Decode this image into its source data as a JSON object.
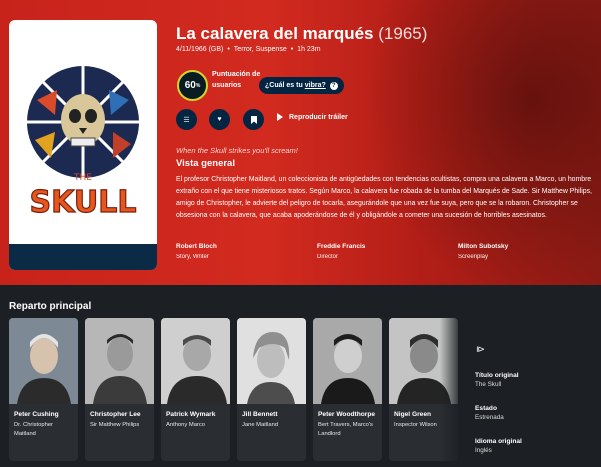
{
  "movie": {
    "title": "La calavera del marqués",
    "year": "(1965)",
    "release": "4/11/1966 (GB)",
    "genres": "Terror, Suspense",
    "runtime": "1h 23m",
    "tagline": "When the Skull strikes you'll scream!",
    "overview_heading": "Vista general",
    "overview": "El profesor Christopher Maitland, un coleccionista de antigüedades con tendencias ocultistas, compra una calavera a Marco, un hombre extraño con el que tiene misteriosos tratos. Según Marco, la calavera fue robada de la tumba del Marqués de Sade. Sir Matthew Philips, amigo de Christopher, le advierte del peligro de tocarla, asegurándole que una vez fue suya, pero que se la robaron. Christopher se obsesiona con la calavera, que acaba apoderándose de él y obligándole a cometer una sucesión de horribles asesinatos."
  },
  "score": {
    "value": "60",
    "unit": "%",
    "label": "Puntuación de usuarios",
    "vibe_label": "¿Cuál es tu",
    "vibe_link": "vibra?",
    "ring_color": "#d2d531"
  },
  "actions": {
    "list_icon": "list-icon",
    "favorite_icon": "heart-icon",
    "watchlist_icon": "bookmark-icon",
    "trailer_label": "Reproducir tráiler"
  },
  "crew": [
    {
      "name": "Robert Bloch",
      "job": "Story, Writer"
    },
    {
      "name": "Freddie Francis",
      "job": "Director"
    },
    {
      "name": "Milton Subotsky",
      "job": "Screenplay"
    }
  ],
  "cast_heading": "Reparto principal",
  "cast": [
    {
      "name": "Peter Cushing",
      "character": "Dr. Christopher Maitland"
    },
    {
      "name": "Christopher Lee",
      "character": "Sir Matthew Philips"
    },
    {
      "name": "Patrick Wymark",
      "character": "Anthony Marco"
    },
    {
      "name": "Jill Bennett",
      "character": "Jane Maitland"
    },
    {
      "name": "Peter Woodthorpe",
      "character": "Bert Travers, Marco's Landlord"
    },
    {
      "name": "Nigel Green",
      "character": "Inspector Wilson"
    }
  ],
  "side": {
    "original_title_label": "Título original",
    "original_title": "The Skull",
    "status_label": "Estado",
    "status": "Estrenada",
    "language_label": "Idioma original",
    "language": "Inglés"
  },
  "colors": {
    "hero": "#c8231b",
    "navy": "#032541",
    "page": "#1c1f23"
  }
}
